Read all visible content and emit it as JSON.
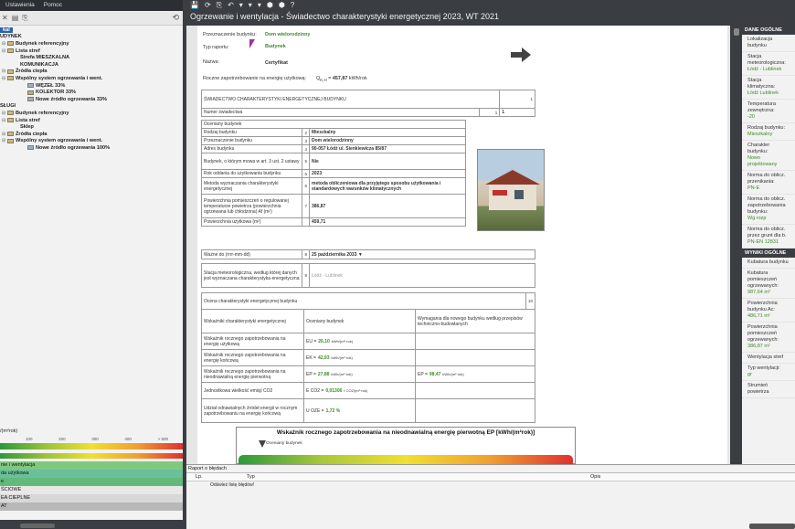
{
  "menu": {
    "items": [
      "Ustawienia",
      "Pomoc"
    ]
  },
  "left": {
    "tree": [
      {
        "label": "kal",
        "type": "header"
      },
      {
        "label": "UDYNEK",
        "type": "bold"
      },
      {
        "label": "Budynek referencyjny",
        "type": "folder"
      },
      {
        "label": "Lista stref",
        "type": "folder"
      },
      {
        "label": "Strefa MIESZKALNA",
        "type": "item2"
      },
      {
        "label": "KOMUNIKACJA",
        "type": "item2"
      },
      {
        "label": "Źródła ciepła",
        "type": "folder"
      },
      {
        "label": "Wspólny system ogrzewania i went.",
        "type": "sys"
      },
      {
        "label": "WĘZEŁ 33%",
        "type": "item2b"
      },
      {
        "label": "KOLEKTOR 33%",
        "type": "item2b"
      },
      {
        "label": "Nowe źródło ogrzewania 33%",
        "type": "item2b"
      },
      {
        "label": "SŁUGI",
        "type": "bold"
      },
      {
        "label": "Budynek referencyjny",
        "type": "folder"
      },
      {
        "label": "Lista stref",
        "type": "folder"
      },
      {
        "label": "Sklep",
        "type": "item2"
      },
      {
        "label": "Źródła ciepła",
        "type": "folder"
      },
      {
        "label": "Wspólny system ogrzewania i went.",
        "type": "sys"
      },
      {
        "label": "Nowe źródło ogrzewania 100%",
        "type": "item2b"
      }
    ],
    "scale_label": "/(m²rok)",
    "scale_ticks": [
      "100",
      "200",
      "300",
      "400",
      "> 500"
    ],
    "categories": [
      {
        "label": "nie i wentylacja",
        "color": "#7fc97f"
      },
      {
        "label": "da użytkowa",
        "color": "#6ac09a"
      },
      {
        "label": "e",
        "color": "#63b97a"
      },
      {
        "label": "ŚCIOWE",
        "color": "#e8e8e8"
      },
      {
        "label": "EA CIEPLNE",
        "color": "#d8d8d8"
      },
      {
        "label": "AT",
        "color": "#b8b8b8"
      }
    ]
  },
  "center": {
    "title": "Ogrzewanie i wentylacja - Świadectwo charakterystyki energetycznej 2023, WT 2021",
    "toolbar_icons": [
      "💾",
      "⟳",
      "⎘",
      "↶",
      "▾",
      "▾",
      "▾",
      "⬢",
      "⬢",
      "?"
    ]
  },
  "doc": {
    "fields": {
      "purpose_label": "Przeznaczenie budynku:",
      "purpose_value": "Dom wielorodzinny",
      "type_label": "Typ raportu:",
      "type_value": "Budynek",
      "name_label": "Nazwa:",
      "name_value": "Certyfikat",
      "demand_label": "Roczne zapotrzebowanie na energię użytkową:",
      "demand_value": "457,87",
      "demand_unit": "kWh/rok"
    },
    "cert_title": "ŚWIADECTWO CHARAKTERYSTYKI ENERGETYCZNEJ BUDYNKU",
    "cert_page": "1",
    "cert_no_label": "Numer świadectwa",
    "cert_no": "1",
    "rows": [
      {
        "label": "Oceniany budynek"
      },
      {
        "label": "Rodzaj budynku",
        "n": "2",
        "value": "Mieszkalny"
      },
      {
        "label": "Przeznaczenie budynku",
        "n": "3",
        "value": "Dom wielorodzinny"
      },
      {
        "label": "Adres budynku",
        "n": "4",
        "value": "90-057 Łódź ul. Sienkiewicza 85/87"
      },
      {
        "label": "Budynek, o którym mowa w art. 3 ust. 2 ustawy",
        "n": "5",
        "value": "Nie"
      },
      {
        "label": "Rok oddania do użytkowania budynku",
        "n": "6",
        "value": "2023"
      },
      {
        "label": "Metoda wyznaczania charakterystyki energetycznej",
        "n": "6",
        "value": "metoda obliczeniowa dla przyjętego sposobu użytkowania i standardowych warunków klimatycznych"
      },
      {
        "label": "Powierzchnia pomieszczeń o regulowanej temperaturze powietrza (powierzchnia ogrzewana lub chłodzona) Af (m²)",
        "n": "7",
        "value": "386,87"
      },
      {
        "label": "Powierzchnia użytkowa (m²)",
        "n": "",
        "value": "459,71"
      }
    ],
    "valid_label": "Ważne do (rrrr-mm-dd)",
    "valid_n": "8",
    "valid_value": "25 października 2033",
    "station_label": "Stacja meteorologiczna, według której danych jest wyznaczana charakterystyka energetyczna",
    "station_n": "9",
    "station_value": "Łódź - Lublinek",
    "assess_label": "Ocena charakterystyki energetycznej budynku",
    "assess_n": "10",
    "ind_head": [
      "Wskaźniki charakterystyki energetycznej",
      "Oceniany budynek",
      "Wymagania dla nowego budynku według przepisów techniczno-budowlanych"
    ],
    "ind_head_n": "11",
    "ind_rows": [
      {
        "label": "Wskaźnik rocznego zapotrzebowania na energię użytkową",
        "sym": "EU =",
        "value": "26,10",
        "unit": "kWh/(m²·rok)",
        "req": ""
      },
      {
        "label": "Wskaźnik rocznego zapotrzebowania na energię końcową",
        "n": "12",
        "sym": "EK =",
        "value": "42,93",
        "unit": "kWh/(m²·rok)",
        "req": ""
      },
      {
        "label": "Wskaźnik rocznego zapotrzebowania na nieodnawialną energię pierwotną",
        "n": "13",
        "sym": "EP =",
        "value": "27,88",
        "unit": "kWh/(m²·rok)",
        "req_sym": "EP =",
        "req": "98,47",
        "req_unit": "kWh/(m²·rok)"
      },
      {
        "label": "Jednostkowa wielkość emisji CO2",
        "sym": "E CO2 =",
        "value": "0,01306",
        "unit": "t CO2/(m²·rok)",
        "req": ""
      },
      {
        "label": "Udział odnawialnych źródeł energii w rocznym zapotrzebowaniu na energię końcową",
        "sym": "U OZE =",
        "value": "1,72 %",
        "unit": "",
        "req": ""
      }
    ],
    "ep_title": "Wskaźnik rocznego zapotrzebowania na nieodnawialną energię pierwotną EP [kWh/(m²rok)]",
    "ep_marker": "Oceniany budynek"
  },
  "right": {
    "sections": [
      {
        "head": "DANE OGÓLNE",
        "rows": [
          {
            "label": "Lokalizacja budynku",
            "value": ""
          },
          {
            "label": "Stacja meteorologiczna:",
            "value": "Łódź - Lublinek"
          },
          {
            "label": "Stacja klimatyczna:",
            "value": "Łódź Lublinek"
          },
          {
            "label": "Temperatura zewnętrzna:",
            "value": "-20"
          },
          {
            "label": "Rodzaj budynku:",
            "value": "Mieszkalny"
          },
          {
            "label": "Charakter budynku:",
            "value": "Nowo projektowany"
          },
          {
            "label": "Norma do oblicz. przenikania:",
            "value": "PN-E"
          },
          {
            "label": "Norma do oblicz. zapotrzebowania budynku:",
            "value": "Wg rozp"
          },
          {
            "label": "Norma do oblicz. przez grunt dla b.",
            "value": "PN-EN 12831"
          }
        ]
      },
      {
        "head": "WYNIKI OGÓLNE",
        "rows": [
          {
            "label": "Kubatura budynku",
            "value": ""
          },
          {
            "label": "Kubatura pomieszczeń ogrzewanych:",
            "value": "987,64 m³"
          },
          {
            "label": "Powierzchnia budynku Ac:",
            "value": "486,71 m²"
          },
          {
            "label": "Powierzchnia pomieszczeń ogrzewanych:",
            "value": "386,87 m²"
          },
          {
            "label": "Wentylacja stref",
            "value": ""
          },
          {
            "label": "Typ wentylacji:",
            "value": "gr"
          },
          {
            "label": "Strumień powietrza",
            "value": ""
          }
        ]
      }
    ]
  },
  "report": {
    "title": "Raport o błędach",
    "cols": [
      "Lp.",
      "Typ",
      "Opis"
    ],
    "refresh": "Odśwież listę błędów!"
  },
  "colors": {
    "accent": "#2d62a8",
    "value_green": "#3f8a2a",
    "dark": "#3a3d42"
  }
}
